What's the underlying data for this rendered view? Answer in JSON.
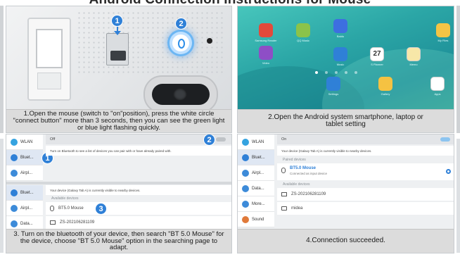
{
  "header": {
    "title": "Android Connection Instructions for Mouse"
  },
  "steps": [
    {
      "caption": "1.Open the mouse (switch to \"on\"position), press the white circle \"connect button\" more than 3 seconds, then you can see the green light or blue light flashing quickly.",
      "marker_switch": "1",
      "marker_button": "2"
    },
    {
      "caption": "2.Open the Android system smartphone, laptop or tablet setting"
    },
    {
      "caption": "3.  Turn on the bluetooth of your device, then search \"BT 5.0 Mouse\" for the device, choose \"BT 5.0 Mouse\" option in the searching page to adapt.",
      "marker_bt": "1",
      "marker_toggle": "2",
      "marker_device": "3"
    },
    {
      "caption": "4.Connection succeeded."
    }
  ],
  "tablet_apps": [
    {
      "label": "Samsung Reader",
      "color": "#e34a3b"
    },
    {
      "label": "QQ Music",
      "color": "#8bc34a"
    },
    {
      "label": "Baidu",
      "color": "#3d6fe0"
    },
    {
      "label": "",
      "color": ""
    },
    {
      "label": "My Files",
      "color": "#f3c445"
    },
    {
      "label": "Video",
      "color": "#8e4ec6"
    },
    {
      "label": "Music",
      "color": "#2f80d7"
    },
    {
      "label": "S Planner",
      "color": "#ffffff"
    },
    {
      "label": "Memo",
      "color": "#f7e7a8"
    },
    {
      "label": "Settings",
      "color": "#2f80d7"
    },
    {
      "label": "Gallery",
      "color": "#f5c242"
    },
    {
      "label": "Apps",
      "color": "#ffffff"
    }
  ],
  "planner_day": "27",
  "settings_p3": {
    "side_top": [
      "WLAN",
      "Bluet...",
      "Airpl..."
    ],
    "side_bottom": [
      "Bluet...",
      "Airpl...",
      "Data..."
    ],
    "wlan_state": "Off",
    "bt_hint": "Turn on Bluetooth to see a list of devices you can pair with or have already paired with.",
    "visible_note": "Your device (Galaxy Tab A) is currently visible to nearby devices.",
    "available_label": "Available devices",
    "devices": [
      "BT5.0 Mouse",
      "ZS-202106281109"
    ]
  },
  "settings_p4": {
    "side": [
      "WLAN",
      "Bluet...",
      "Airpl...",
      "Data...",
      "More...",
      "Sound"
    ],
    "on_state": "On",
    "visible_note": "Your device (Galaxy Tab A) is currently visible to nearby devices.",
    "paired_label": "Paired devices",
    "paired_name": "BT5.0 Mouse",
    "paired_sub": "Connected as input device",
    "available_label": "Available devices",
    "devices": [
      "ZS-202106281109",
      "midea"
    ]
  }
}
